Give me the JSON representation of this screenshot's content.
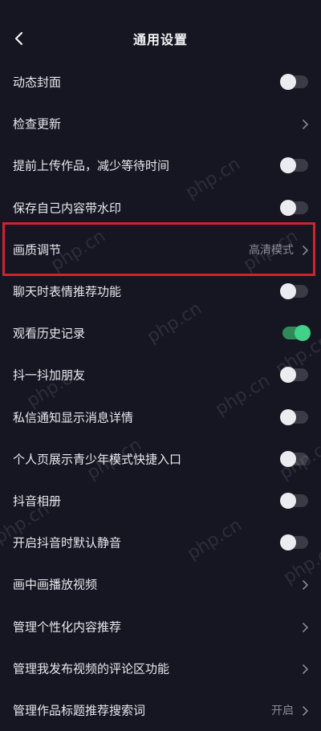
{
  "header": {
    "title": "通用设置",
    "back_icon": "chevron-left-icon"
  },
  "settings": [
    {
      "label": "动态封面",
      "control": "toggle",
      "state": "off"
    },
    {
      "label": "检查更新",
      "control": "chevron"
    },
    {
      "label": "提前上传作品，减少等待时间",
      "control": "toggle",
      "state": "off"
    },
    {
      "label": "保存自己内容带水印",
      "control": "toggle",
      "state": "off"
    },
    {
      "label": "画质调节",
      "control": "chevron",
      "value": "高清模式",
      "highlighted": true
    },
    {
      "label": "聊天时表情推荐功能",
      "control": "toggle",
      "state": "off"
    },
    {
      "label": "观看历史记录",
      "control": "toggle",
      "state": "on"
    },
    {
      "label": "抖一抖加朋友",
      "control": "toggle",
      "state": "off"
    },
    {
      "label": "私信通知显示消息详情",
      "control": "toggle",
      "state": "off"
    },
    {
      "label": "个人页展示青少年模式快捷入口",
      "control": "toggle",
      "state": "off"
    },
    {
      "label": "抖音相册",
      "control": "toggle",
      "state": "off"
    },
    {
      "label": "开启抖音时默认静音",
      "control": "toggle",
      "state": "off"
    },
    {
      "label": "画中画播放视频",
      "control": "chevron"
    },
    {
      "label": "管理个性化内容推荐",
      "control": "chevron"
    },
    {
      "label": "管理我发布视频的评论区功能",
      "control": "chevron"
    },
    {
      "label": "管理作品标题推荐搜索词",
      "control": "chevron",
      "value": "开启"
    }
  ],
  "watermark": "php.cn",
  "colors": {
    "background": "#161622",
    "toggle_on": "#43d08a",
    "highlight_border": "#d0232e"
  }
}
